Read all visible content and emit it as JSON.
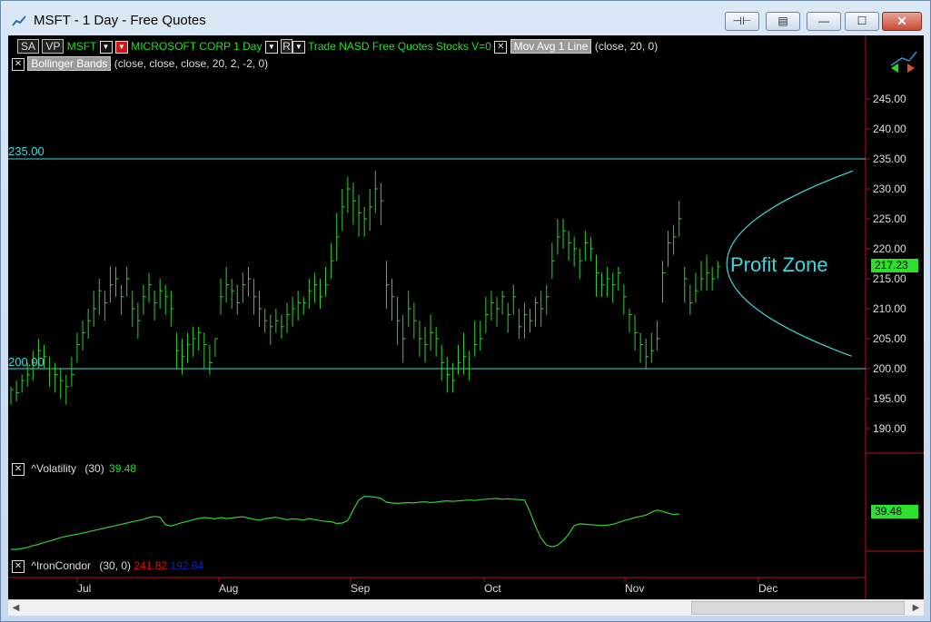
{
  "window": {
    "title": "MSFT - 1 Day - Free Quotes"
  },
  "titlebar_buttons": {
    "pin": "⊣⊢",
    "restore_alt": "▤",
    "minimize": "—",
    "maximize": "☐",
    "close": "✕"
  },
  "header": {
    "sa": "SA",
    "vp": "VP",
    "symbol": "MSFT",
    "company": "MICROSOFT CORP",
    "interval": "1 Day",
    "r": "R",
    "info": "Trade  NASD  Free Quotes  Stocks   V=0",
    "mov_avg": {
      "label": "Mov Avg 1 Line",
      "params": "(close,  20,  0)"
    },
    "bollinger": {
      "label": "Bollinger Bands",
      "params": "(close,  close,  close,  20,  2,  -2,  0)"
    }
  },
  "volatility": {
    "label": "^Volatility",
    "params": "(30)",
    "value": "39.48",
    "badge": "39.48"
  },
  "ironcondor": {
    "label": "^IronCondor",
    "params": "(30,  0)",
    "upper": "241.82",
    "lower": "192.84"
  },
  "annotation": {
    "text": "Profit Zone",
    "upper_line_label": "235.00",
    "lower_line_label": "200.00"
  },
  "price_badge": "217.23",
  "colors": {
    "bars": "#2fd02f",
    "lines": "#3fd8e0",
    "text_green": "#22e022",
    "badge_green": "#2ee02e",
    "red": "#e01010",
    "blue": "#1020d0"
  },
  "chart_data": {
    "type": "line",
    "price_axis": {
      "ticks": [
        190,
        195,
        200,
        205,
        210,
        215,
        220,
        225,
        230,
        235,
        240,
        245
      ],
      "tick_labels": [
        "190.00",
        "195.00",
        "200.00",
        "205.00",
        "210.00",
        "215.00",
        "220.00",
        "225.00",
        "230.00",
        "235.00",
        "240.00",
        "245.00"
      ]
    },
    "x_labels": [
      "Jul",
      "Aug",
      "Sep",
      "Oct",
      "Nov",
      "Dec"
    ],
    "horizontal_lines": [
      235,
      200
    ],
    "last_price": 217.23,
    "ohlc": [
      [
        196.5,
        194,
        197
      ],
      [
        196,
        194.5,
        198
      ],
      [
        198,
        196,
        199
      ],
      [
        199,
        197,
        201
      ],
      [
        201,
        198,
        203
      ],
      [
        203,
        200,
        205
      ],
      [
        202,
        200,
        204
      ],
      [
        200,
        197,
        202
      ],
      [
        199,
        196,
        201
      ],
      [
        198,
        195,
        200
      ],
      [
        197,
        194,
        199
      ],
      [
        199,
        197,
        202
      ],
      [
        204,
        201,
        206
      ],
      [
        206,
        203,
        208
      ],
      [
        208,
        205,
        210
      ],
      [
        210,
        207,
        213
      ],
      [
        213,
        209,
        215
      ],
      [
        211,
        208,
        213
      ],
      [
        214,
        211,
        217
      ],
      [
        215,
        212,
        217
      ],
      [
        212,
        209,
        214
      ],
      [
        215,
        212,
        217
      ],
      [
        210,
        207,
        213
      ],
      [
        208,
        205,
        211
      ],
      [
        212,
        209,
        214
      ],
      [
        214,
        211,
        216
      ],
      [
        211,
        208,
        213
      ],
      [
        213,
        210,
        215
      ],
      [
        212,
        209,
        214
      ],
      [
        210,
        207,
        213
      ],
      [
        203,
        200,
        206
      ],
      [
        202,
        199,
        205
      ],
      [
        204,
        201,
        206
      ],
      [
        205,
        202,
        207
      ],
      [
        206,
        203,
        207
      ],
      [
        204,
        200,
        206
      ],
      [
        201,
        199,
        204
      ],
      [
        205,
        202,
        205
      ],
      [
        212,
        209,
        215
      ],
      [
        214,
        211,
        217
      ],
      [
        213,
        210,
        215
      ],
      [
        211,
        209,
        214
      ],
      [
        214,
        211,
        216
      ],
      [
        215,
        212,
        217
      ],
      [
        212,
        209,
        215
      ],
      [
        210,
        207,
        213
      ],
      [
        208,
        206,
        210
      ],
      [
        207,
        204,
        209
      ],
      [
        208,
        206,
        210
      ],
      [
        207,
        205,
        209
      ],
      [
        209,
        206,
        211
      ],
      [
        210,
        207,
        212
      ],
      [
        211,
        208,
        213
      ],
      [
        211,
        209,
        212
      ],
      [
        213,
        210,
        215
      ],
      [
        214,
        211,
        216
      ],
      [
        212,
        210,
        215
      ],
      [
        214,
        212,
        217
      ],
      [
        218,
        215,
        221
      ],
      [
        222,
        218,
        226
      ],
      [
        227,
        223,
        230
      ],
      [
        230,
        226,
        232
      ],
      [
        228,
        224,
        231
      ],
      [
        226,
        222,
        229
      ],
      [
        225,
        222,
        227
      ],
      [
        227,
        223,
        230
      ],
      [
        230,
        226,
        233
      ],
      [
        228,
        224,
        231
      ],
      [
        214,
        210,
        218
      ],
      [
        212,
        208,
        215
      ],
      [
        208,
        204,
        212
      ],
      [
        205,
        201,
        209
      ],
      [
        210,
        207,
        213
      ],
      [
        208,
        205,
        211
      ],
      [
        205,
        202,
        208
      ],
      [
        204,
        201,
        207
      ],
      [
        206,
        203,
        209
      ],
      [
        205,
        202,
        207
      ],
      [
        201,
        198,
        204
      ],
      [
        199,
        196,
        202
      ],
      [
        198,
        196,
        201
      ],
      [
        201,
        199,
        204
      ],
      [
        202,
        199,
        206
      ],
      [
        200,
        198,
        203
      ],
      [
        204,
        202,
        208
      ],
      [
        205,
        203,
        208
      ],
      [
        209,
        206,
        212
      ],
      [
        211,
        208,
        213
      ],
      [
        210,
        207,
        212
      ],
      [
        212,
        209,
        213
      ],
      [
        209,
        206,
        211
      ],
      [
        212,
        209,
        214
      ],
      [
        207,
        205,
        210
      ],
      [
        209,
        205,
        211
      ],
      [
        208,
        206,
        210
      ],
      [
        211,
        207,
        212
      ],
      [
        210,
        207,
        213
      ],
      [
        212,
        209,
        214
      ],
      [
        218,
        215,
        221
      ],
      [
        222,
        219,
        225
      ],
      [
        223,
        220,
        225
      ],
      [
        221,
        218,
        223
      ],
      [
        220,
        217,
        222
      ],
      [
        218,
        215,
        220
      ],
      [
        221,
        218,
        223
      ],
      [
        220,
        218,
        222
      ],
      [
        216,
        212,
        219
      ],
      [
        214,
        212,
        216
      ],
      [
        215,
        212,
        217
      ],
      [
        214,
        211,
        216
      ],
      [
        216,
        213,
        217
      ],
      [
        212,
        209,
        214
      ],
      [
        209,
        206,
        210
      ],
      [
        206,
        203,
        209
      ],
      [
        204,
        201,
        206
      ],
      [
        202,
        200,
        205
      ],
      [
        203,
        201,
        206
      ],
      [
        205,
        203,
        208
      ],
      [
        216,
        211,
        218
      ],
      [
        221,
        217,
        223
      ],
      [
        222,
        219,
        224
      ],
      [
        225,
        222,
        228
      ],
      [
        215,
        211,
        217
      ],
      [
        211,
        209,
        214
      ],
      [
        213,
        211,
        216
      ],
      [
        215,
        213,
        218
      ],
      [
        216,
        213,
        219
      ],
      [
        215,
        213,
        217
      ],
      [
        217,
        215,
        218
      ]
    ],
    "volatility_series": [
      31,
      31,
      31.2,
      31.5,
      31.9,
      32.2,
      32.6,
      33,
      33.4,
      33.8,
      34.1,
      34.4,
      34.6,
      34.9,
      35.2,
      35.5,
      35.8,
      36.1,
      36.4,
      36.7,
      37,
      37.3,
      37.6,
      37.9,
      38.2,
      38.6,
      38.9,
      38.7,
      36.9,
      36.6,
      37,
      37.4,
      37.7,
      38.1,
      38.4,
      38.6,
      38.5,
      38.3,
      38.6,
      38.4,
      38.5,
      38.7,
      38.8,
      38.5,
      38.2,
      38.0,
      38.3,
      38.5,
      38.7,
      38.4,
      38.1,
      38.3,
      38.2,
      38.0,
      38.4,
      38.1,
      37.9,
      37.7,
      37.6,
      37.2,
      37.3,
      37.9,
      40.5,
      42.8,
      43.7,
      43.6,
      43.5,
      43.2,
      42.3,
      42.1,
      42.0,
      42.1,
      42.2,
      42.1,
      42.3,
      42.4,
      42.2,
      42.3,
      42.5,
      42.6,
      42.5,
      42.6,
      42.7,
      42.8,
      42.7,
      42.9,
      43.0,
      43.1,
      43.2,
      43.0,
      43.1,
      43.0,
      42.9,
      42.8,
      40.0,
      36.5,
      33.7,
      32.0,
      31.6,
      32.0,
      33.1,
      34.6,
      36.7,
      37.1,
      37.0,
      36.9,
      36.8,
      36.7,
      36.8,
      37.0,
      37.4,
      37.9,
      38.2,
      38.6,
      38.9,
      39.2,
      39.9,
      40.4,
      40.1,
      39.7,
      39.3,
      39.5
    ]
  }
}
